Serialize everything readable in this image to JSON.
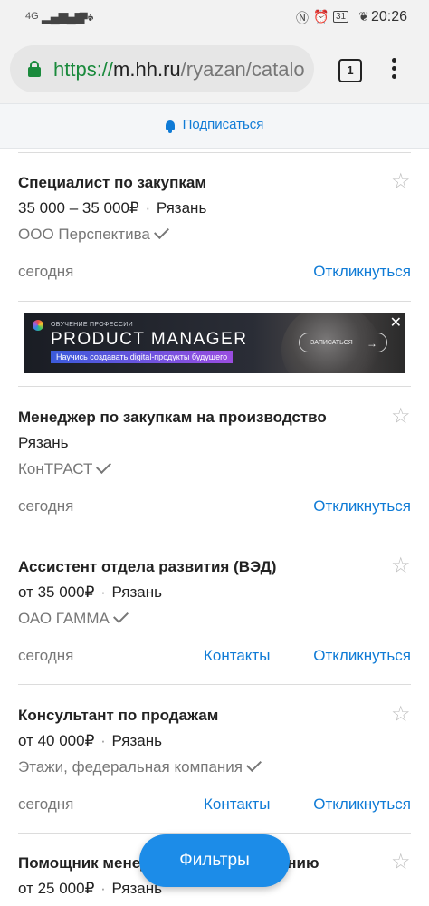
{
  "status_bar": {
    "signal_left": "4G",
    "battery": "31",
    "time": "20:26"
  },
  "browser": {
    "url_scheme": "https://",
    "url_host": "m.hh.ru",
    "url_path": "/ryazan/catalo",
    "tab_count": "1"
  },
  "subscribe": {
    "label": "Подписаться"
  },
  "banner": {
    "small_text": "ОБУЧЕНИЕ ПРОФЕССИИ",
    "big_text": "PRODUCT MANAGER",
    "strip_text": "Научись создавать digital-продукты будущего",
    "button_label": "ЗАПИСАТЬСЯ",
    "close": "✕"
  },
  "vacancies": [
    {
      "title": "Специалист по закупкам",
      "salary": "35 000 – 35 000₽",
      "city": "Рязань",
      "company": "ООО Перспектива",
      "date": "сегодня",
      "contacts": "",
      "respond": "Откликнуться"
    },
    {
      "title": "Менеджер по закупкам на производство",
      "salary": "",
      "city": "Рязань",
      "company": "КонТРАСТ",
      "date": "сегодня",
      "contacts": "",
      "respond": "Откликнуться"
    },
    {
      "title": "Ассистент отдела развития (ВЭД)",
      "salary": "от 35 000₽",
      "city": "Рязань",
      "company": "ОАО ГАММА",
      "date": "сегодня",
      "contacts": "Контакты",
      "respond": "Откликнуться"
    },
    {
      "title": "Консультант по продажам",
      "salary": "от 40 000₽",
      "city": "Рязань",
      "company": "Этажи, федеральная компания",
      "date": "сегодня",
      "contacts": "Контакты",
      "respond": "Откликнуться"
    },
    {
      "title": "Помощник менеджера по направлению",
      "salary": "от 25 000₽",
      "city": "Рязань",
      "company": "",
      "date": "",
      "contacts": "",
      "respond": ""
    }
  ],
  "filters_button": "Фильтры",
  "icons": {
    "star": "☆"
  },
  "colors": {
    "accent": "#0f7bd6",
    "secure": "#1a8a3c",
    "fab": "#1c8ce8"
  }
}
